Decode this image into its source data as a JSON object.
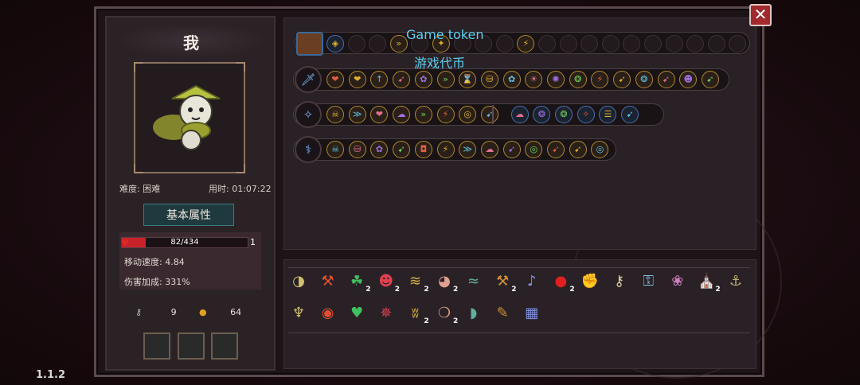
{
  "player": {
    "name": "我"
  },
  "info": {
    "difficulty": "难度: 困难",
    "time": "用时: 01:07:22"
  },
  "attributes": {
    "tab_label": "基本属性",
    "hp_text": "82/434",
    "hp_fraction": 0.19,
    "hp_level": "1",
    "move_speed": "移动速度: 4.84",
    "damage_bonus": "伤害加成: 331%"
  },
  "resources": {
    "keys": "9",
    "coins": "64"
  },
  "version": "1.1.2",
  "annotation": {
    "en": "Game token",
    "zh": "游戏代币"
  },
  "close_label": "✕",
  "token_row": {
    "icons": [
      "◈",
      "»",
      "✦",
      "⚡"
    ]
  },
  "weapon_rows": [
    {
      "weapon_icon": "🗡",
      "glyphs": [
        "❤",
        "❤",
        "↑",
        "➹",
        "✿",
        "»",
        "⌛",
        "⛁",
        "✿",
        "☀",
        "✺",
        "❂",
        "⚡",
        "➹",
        "❂",
        "➹",
        "☻",
        "➹"
      ]
    },
    {
      "weapon_icon": "✧",
      "glyphs": [
        "☠",
        "≫",
        "❤",
        "☁",
        "»",
        "⚡",
        "◎",
        "➹",
        "☁",
        "❂",
        "❂",
        "✧",
        "☰",
        "➹"
      ]
    },
    {
      "weapon_icon": "⚕",
      "glyphs": [
        "☠",
        "⛁",
        "✿",
        "➹",
        "◘",
        "⚡",
        "≫",
        "☁",
        "➹",
        "◎",
        "➹",
        "➹",
        "◎"
      ]
    }
  ],
  "inventory": {
    "items": [
      {
        "icon": "◑",
        "count": ""
      },
      {
        "icon": "⚒",
        "count": ""
      },
      {
        "icon": "☘",
        "count": "2"
      },
      {
        "icon": "☻",
        "count": "2"
      },
      {
        "icon": "≋",
        "count": "2"
      },
      {
        "icon": "◕",
        "count": "2"
      },
      {
        "icon": "≈",
        "count": ""
      },
      {
        "icon": "⚒",
        "count": "2"
      },
      {
        "icon": "♪",
        "count": ""
      },
      {
        "icon": "●",
        "count": "2"
      },
      {
        "icon": "✊",
        "count": ""
      },
      {
        "icon": "⚷",
        "count": ""
      },
      {
        "icon": "⚿",
        "count": ""
      },
      {
        "icon": "❀",
        "count": ""
      },
      {
        "icon": "⛪",
        "count": "2"
      },
      {
        "icon": "⚓",
        "count": ""
      },
      {
        "icon": "♆",
        "count": ""
      },
      {
        "icon": "◉",
        "count": ""
      },
      {
        "icon": "♥",
        "count": ""
      },
      {
        "icon": "✵",
        "count": ""
      },
      {
        "icon": "ʬ",
        "count": "2"
      },
      {
        "icon": "❍",
        "count": "2"
      },
      {
        "icon": "◗",
        "count": ""
      },
      {
        "icon": "✎",
        "count": ""
      },
      {
        "icon": "▦",
        "count": ""
      }
    ]
  },
  "colors": {
    "accent_gold": "#b08830",
    "hp_red": "#c8232a",
    "annotation": "#5ad0f0"
  }
}
